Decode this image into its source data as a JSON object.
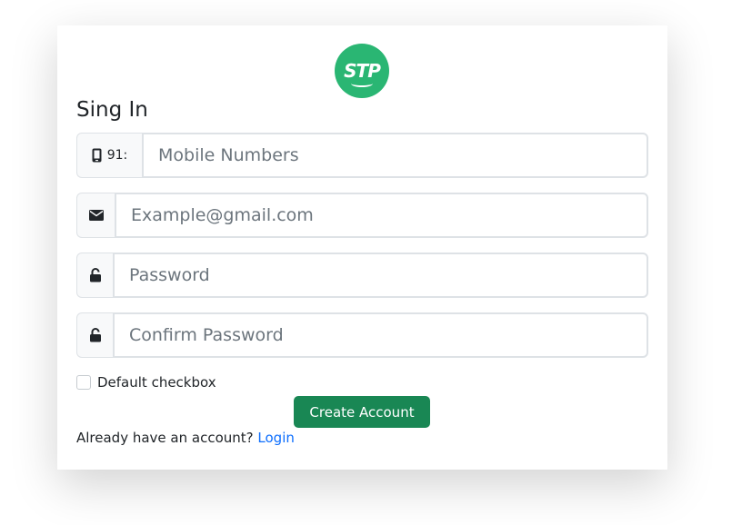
{
  "logo": {
    "text": "STP",
    "color": "#2ab673"
  },
  "title": "Sing In",
  "fields": {
    "mobile": {
      "prefix": "91:",
      "placeholder": "Mobile Numbers",
      "icon": "mobile-icon"
    },
    "email": {
      "placeholder": "Example@gmail.com",
      "icon": "envelope-icon"
    },
    "password": {
      "placeholder": "Password",
      "icon": "unlock-icon"
    },
    "confirm_password": {
      "placeholder": "Confirm Password",
      "icon": "unlock-icon"
    }
  },
  "checkbox": {
    "label": "Default checkbox",
    "checked": false
  },
  "button": {
    "label": "Create Account",
    "color": "#198754"
  },
  "login": {
    "prompt": "Already have an account?",
    "link_label": "Login",
    "link_color": "#0d6efd"
  }
}
